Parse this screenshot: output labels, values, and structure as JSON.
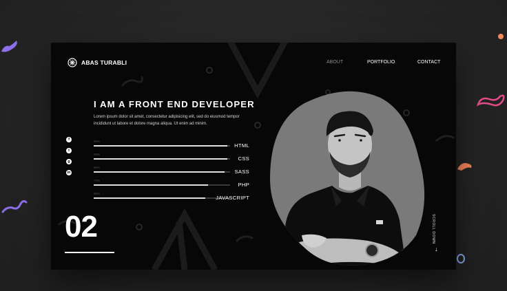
{
  "header": {
    "brand": "ABAS TURABLI",
    "nav": [
      {
        "label": "ABOUT",
        "active": true
      },
      {
        "label": "PORTFOLIO",
        "active": false
      },
      {
        "label": "CONTACT",
        "active": false
      }
    ]
  },
  "hero": {
    "headline": "I AM A FRONT END DEVELOPER",
    "intro": "Lorem ipsum dolor sit amet, consectetur adipisicing elit, sed do eiusmod tempor incididunt ut labore et dolore magna aliqua. Ut enim ad minim."
  },
  "social_icons": [
    "facebook-icon",
    "twitter-icon",
    "github-icon",
    "linkedin-icon"
  ],
  "skills": [
    {
      "name": "HTML",
      "percent_label": "98%",
      "level": 0.98
    },
    {
      "name": "CSS",
      "percent_label": "98%",
      "level": 0.98
    },
    {
      "name": "SASS",
      "percent_label": "96%",
      "level": 0.96
    },
    {
      "name": "PHP",
      "percent_label": "70%",
      "level": 0.84
    },
    {
      "name": "JAVASCRIPT",
      "percent_label": "85%",
      "level": 0.82
    }
  ],
  "section_number": "02",
  "scroll_label": "SCROLL DOWN",
  "colors": {
    "page_bg": "#262626",
    "card_bg": "#070707",
    "blob_grey": "#7a7a7a",
    "accent_purple": "#8d6fe8",
    "accent_pink": "#e64c8a",
    "accent_orange": "#f2855a",
    "accent_blue": "#86a6ef"
  }
}
